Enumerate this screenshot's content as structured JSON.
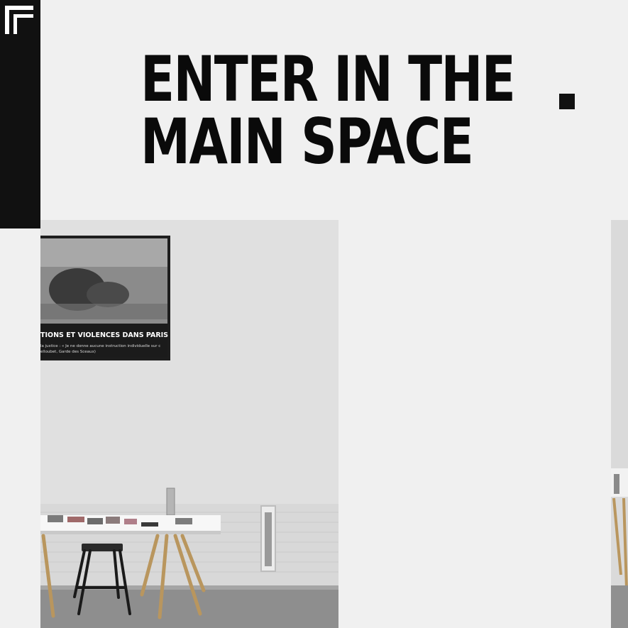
{
  "header": {
    "logo_icon": "brand-logo-icon",
    "title_line1": "ENTER IN THE",
    "title_line2": "MAIN SPACE",
    "accent_mark_icon": "square-dot-icon"
  },
  "gallery": {
    "poster": {
      "headline": "TIONS ET VIOLENCES DANS PARIS",
      "caption_line1": "la justice : « Je ne donne aucune instruction individuelle sur c",
      "caption_line2": "elloubet, Garde des Sceaux)"
    }
  },
  "colors": {
    "background": "#f0f0f0",
    "sidebar": "#111111",
    "text": "#0a0a0a"
  }
}
